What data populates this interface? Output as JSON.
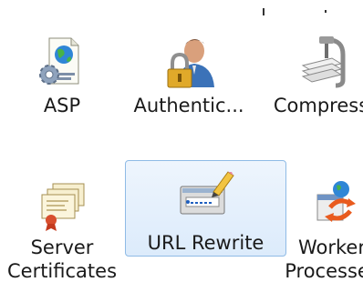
{
  "features": {
    "row1": [
      {
        "label": "ASP",
        "icon": "asp-icon"
      },
      {
        "label": "Authentic...",
        "icon": "authentication-icon"
      },
      {
        "label": "Compress",
        "icon": "compression-icon"
      }
    ],
    "row2": [
      {
        "label_line1": "Server",
        "label_line2": "Certificates",
        "icon": "server-certificates-icon"
      },
      {
        "label": "URL Rewrite",
        "icon": "url-rewrite-icon",
        "selected": true
      },
      {
        "label_line1": "Worker",
        "label_line2": "Processes",
        "icon": "worker-processes-icon"
      }
    ]
  },
  "colors": {
    "selection_fill": "#dcebfb",
    "selection_border": "#8fbbe6"
  }
}
